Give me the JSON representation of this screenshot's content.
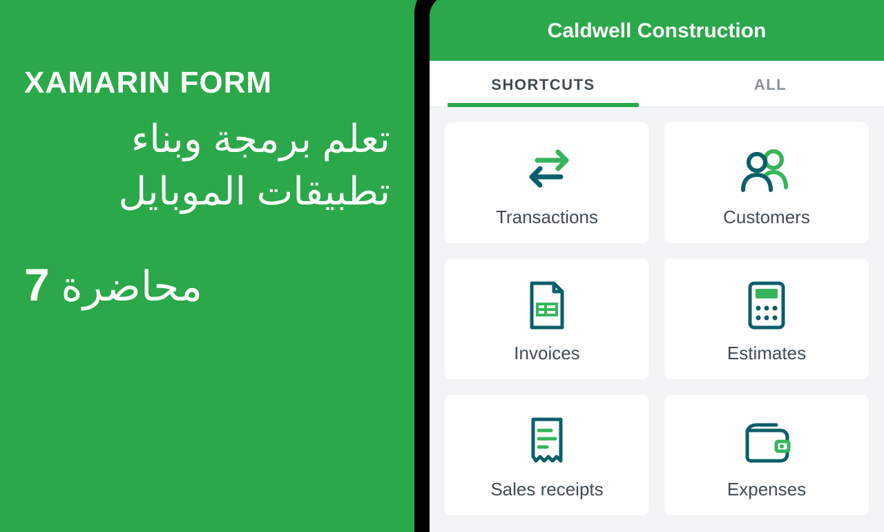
{
  "left": {
    "heading_en": "XAMARIN FORM",
    "arabic_line1": "تعلم برمجة وبناء",
    "arabic_line2": "تطبيقات الموبايل",
    "lecture_label": "محاضرة",
    "lecture_number": "7"
  },
  "app": {
    "title": "Caldwell Construction",
    "tabs": {
      "shortcuts": "SHORTCUTS",
      "all": "ALL",
      "active": "shortcuts"
    },
    "tiles": {
      "transactions": "Transactions",
      "customers": "Customers",
      "invoices": "Invoices",
      "estimates": "Estimates",
      "sales_receipts": "Sales receipts",
      "expenses": "Expenses"
    }
  },
  "colors": {
    "accent_green": "#2aa84a",
    "dark_teal": "#0b5e6b",
    "icon_green": "#35b55a"
  }
}
